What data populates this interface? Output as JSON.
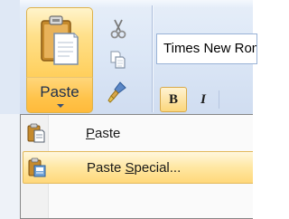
{
  "clipboard_group": {
    "paste_button": {
      "label": "Paste",
      "icon": "clipboard-paste-icon"
    },
    "cut_icon": "scissors-icon",
    "copy_icon": "copy-icon",
    "format_painter_icon": "format-painter-icon"
  },
  "font_group": {
    "font_name": "Times New Roman",
    "bold_label": "B",
    "italic_label": "I"
  },
  "paste_menu": {
    "items": [
      {
        "label_prefix": "",
        "mnemonic": "P",
        "label_suffix": "aste",
        "icon": "clipboard-paste-icon",
        "highlighted": false
      },
      {
        "label_prefix": "Paste ",
        "mnemonic": "S",
        "label_suffix": "pecial...",
        "icon": "paste-special-icon",
        "highlighted": true
      }
    ]
  },
  "colors": {
    "ribbon_background": "#dce7f6",
    "hover_highlight": "#ffd87a",
    "menu_border": "#868686"
  }
}
